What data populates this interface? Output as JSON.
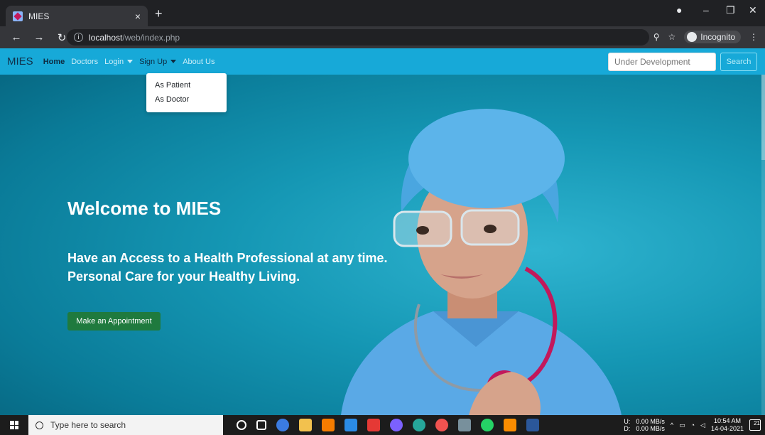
{
  "browser": {
    "tab_title": "MIES",
    "tab_close": "×",
    "new_tab": "+",
    "url_host": "localhost",
    "url_path": "/web/index.php",
    "incognito_label": "Incognito"
  },
  "site": {
    "brand": "MIES",
    "nav": [
      {
        "label": "Home",
        "active": true
      },
      {
        "label": "Doctors"
      },
      {
        "label": "Login"
      },
      {
        "label": "Sign Up"
      },
      {
        "label": "About Us"
      }
    ],
    "search": {
      "placeholder": "Under Development",
      "button": "Search"
    },
    "signup_dropdown": [
      "As Patient",
      "As Doctor"
    ]
  },
  "hero": {
    "title": "Welcome to MIES",
    "subtitle_line1": "Have an Access to a Health Professional at any time.",
    "subtitle_line2": "Personal Care for your Healthy Living.",
    "cta": "Make an Appointment"
  },
  "taskbar": {
    "search_placeholder": "Type here to search",
    "net_up": "0.00 MB/s",
    "net_down": "0.00 MB/s",
    "net_up_label": "U:",
    "net_down_label": "D:",
    "time": "10:54 AM",
    "date": "14-04-2021",
    "notif_count": "21"
  },
  "colors": {
    "navbar": "#17a9d8",
    "cta": "#1f7a3e",
    "hero_bg": "#1597b4"
  }
}
